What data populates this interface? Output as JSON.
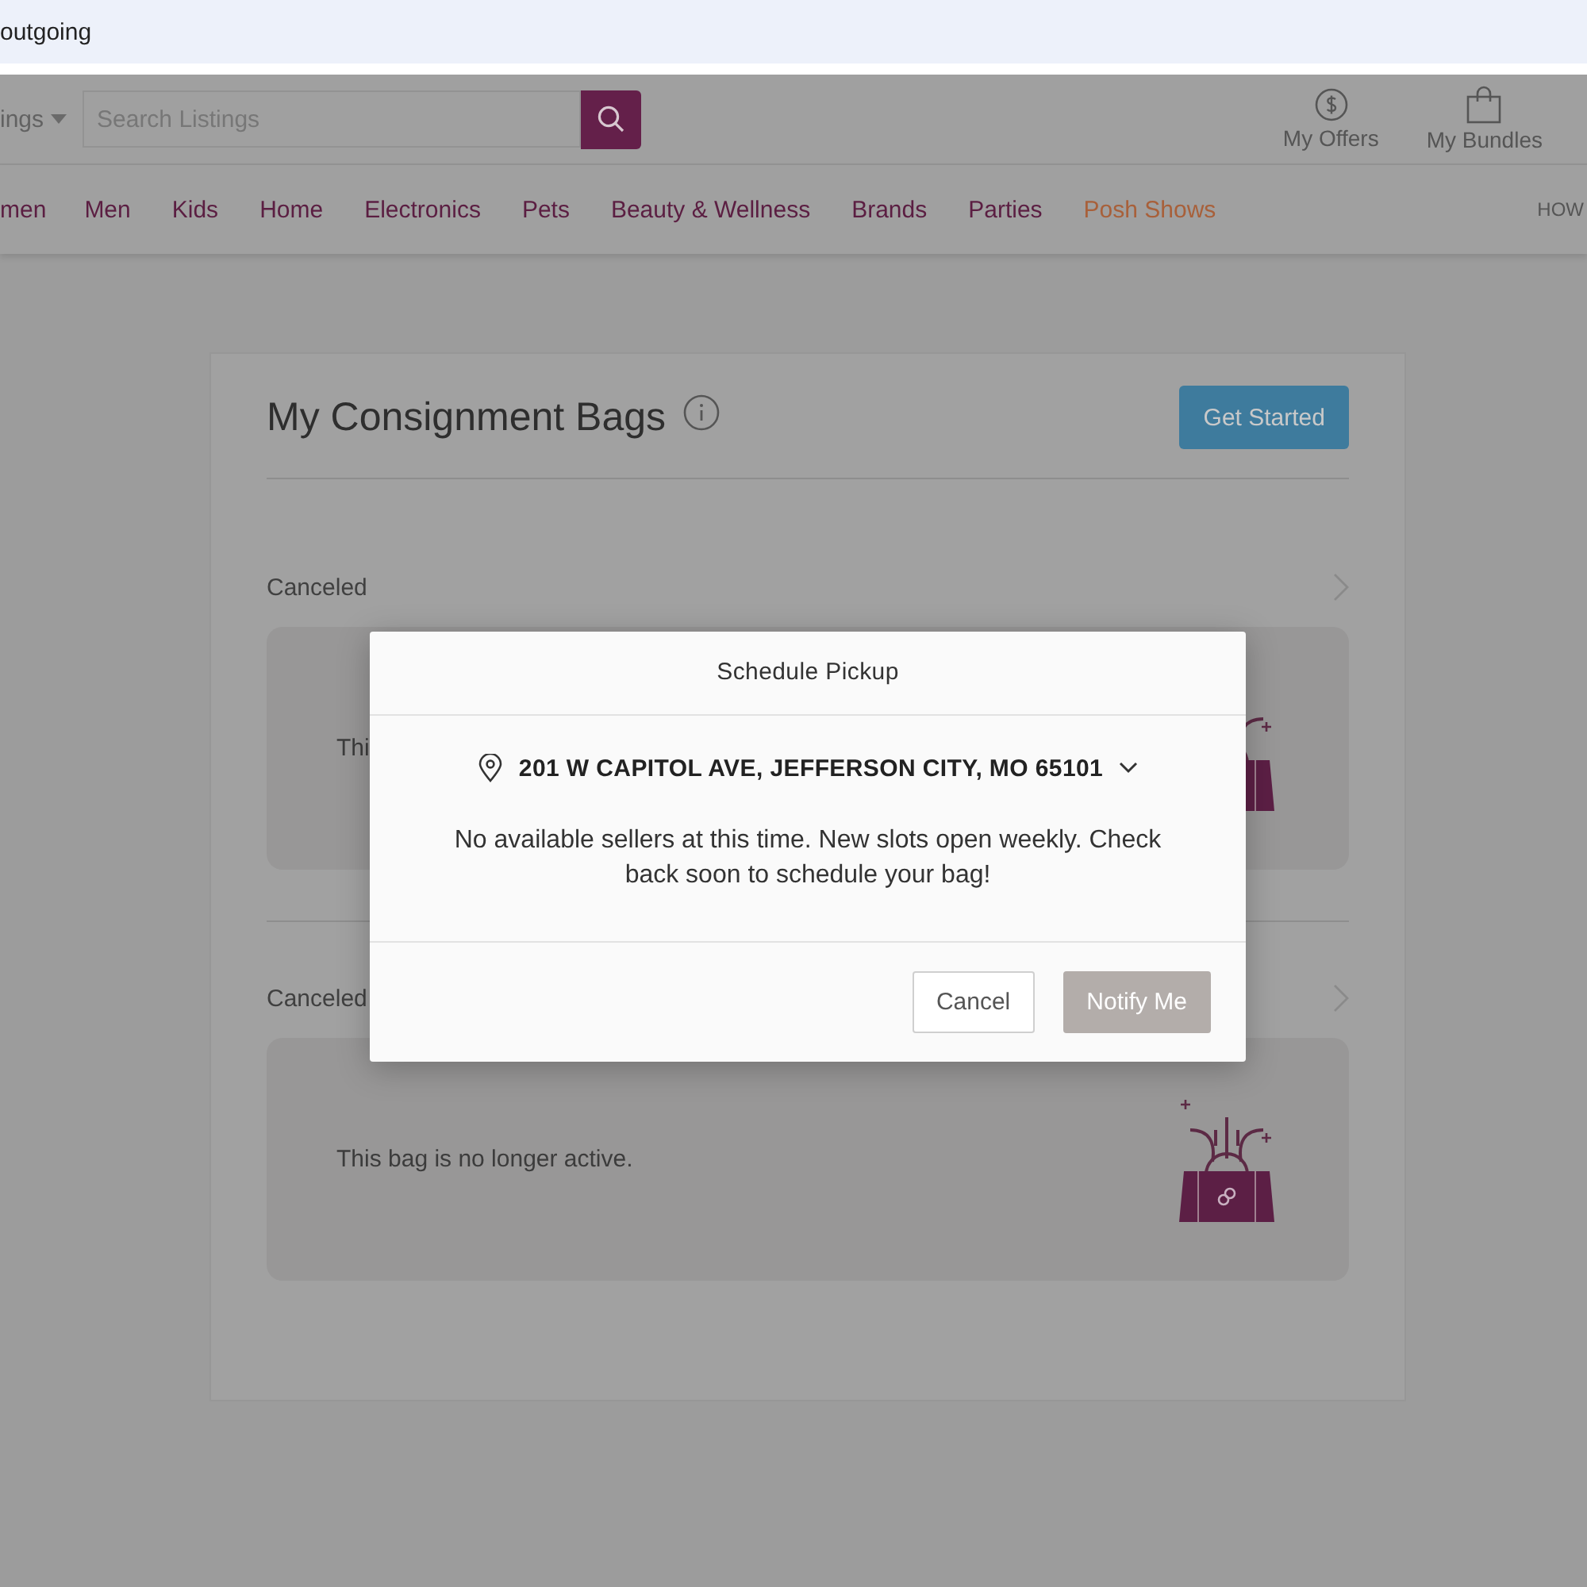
{
  "browser_bar": {
    "text": "outgoing"
  },
  "header": {
    "category": "ings",
    "search": {
      "placeholder": "Search Listings"
    },
    "actions": [
      {
        "kind": "offers",
        "label": "My Offers"
      },
      {
        "kind": "bundles",
        "label": "My Bundles"
      }
    ]
  },
  "nav": {
    "items": [
      {
        "label": "men",
        "highlighted": false
      },
      {
        "label": "Men",
        "highlighted": false
      },
      {
        "label": "Kids",
        "highlighted": false
      },
      {
        "label": "Home",
        "highlighted": false
      },
      {
        "label": "Electronics",
        "highlighted": false
      },
      {
        "label": "Pets",
        "highlighted": false
      },
      {
        "label": "Beauty & Wellness",
        "highlighted": false
      },
      {
        "label": "Brands",
        "highlighted": false
      },
      {
        "label": "Parties",
        "highlighted": false
      },
      {
        "label": "Posh Shows",
        "highlighted": true
      }
    ],
    "right_link": "HOW"
  },
  "page": {
    "title": "My Consignment Bags",
    "button": "Get Started",
    "bags": [
      {
        "status": "Canceled",
        "message": "Thi"
      },
      {
        "status": "Canceled",
        "message": "This bag is no longer active."
      }
    ]
  },
  "modal": {
    "title": "Schedule Pickup",
    "address": "201 W CAPITOL AVE, JEFFERSON CITY, MO 65101",
    "message": "No available sellers at this time. New slots open weekly. Check back soon to schedule your bag!",
    "buttons": [
      {
        "label": "Cancel",
        "kind": "secondary",
        "disabled": false
      },
      {
        "label": "Notify Me",
        "kind": "primary",
        "disabled": true
      }
    ]
  }
}
